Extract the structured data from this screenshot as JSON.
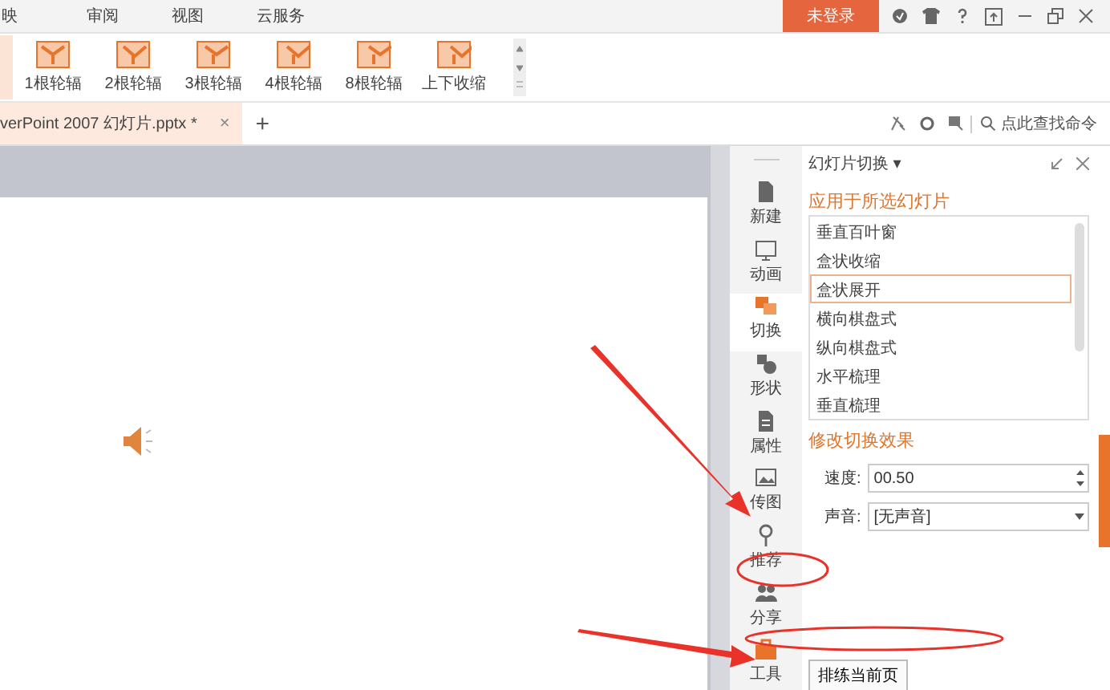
{
  "menu_tabs": [
    "映",
    "审阅",
    "视图",
    "云服务"
  ],
  "login_button": "未登录",
  "ribbon_gallery": [
    "1根轮辐",
    "2根轮辐",
    "3根轮辐",
    "4根轮辐",
    "8根轮辐",
    "上下收缩"
  ],
  "document_tab": {
    "title": "verPoint 2007 幻灯片.pptx *",
    "close": "×",
    "new_tab": "+"
  },
  "search": {
    "placeholder": "点此查找命令"
  },
  "side_tabs": [
    {
      "label": "新建",
      "selected": false
    },
    {
      "label": "动画",
      "selected": false
    },
    {
      "label": "切换",
      "selected": true
    },
    {
      "label": "形状",
      "selected": false
    },
    {
      "label": "属性",
      "selected": false
    },
    {
      "label": "传图",
      "selected": false
    },
    {
      "label": "推荐",
      "selected": false
    },
    {
      "label": "分享",
      "selected": false
    },
    {
      "label": "工具",
      "selected": false
    }
  ],
  "panel": {
    "title": "幻灯片切换",
    "title_caret": "▾",
    "apply_heading": "应用于所选幻灯片",
    "transitions": [
      {
        "label": "垂直百叶窗",
        "selected": false
      },
      {
        "label": "盒状收缩",
        "selected": false
      },
      {
        "label": "盒状展开",
        "selected": true
      },
      {
        "label": "横向棋盘式",
        "selected": false
      },
      {
        "label": "纵向棋盘式",
        "selected": false
      },
      {
        "label": "水平梳理",
        "selected": false
      },
      {
        "label": "垂直梳理",
        "selected": false
      }
    ],
    "modify_heading": "修改切换效果",
    "speed": {
      "label": "速度:",
      "value": "00.50"
    },
    "sound": {
      "label": "声音:",
      "value": "[无声音]"
    },
    "rehearse_button": "排练当前页"
  }
}
